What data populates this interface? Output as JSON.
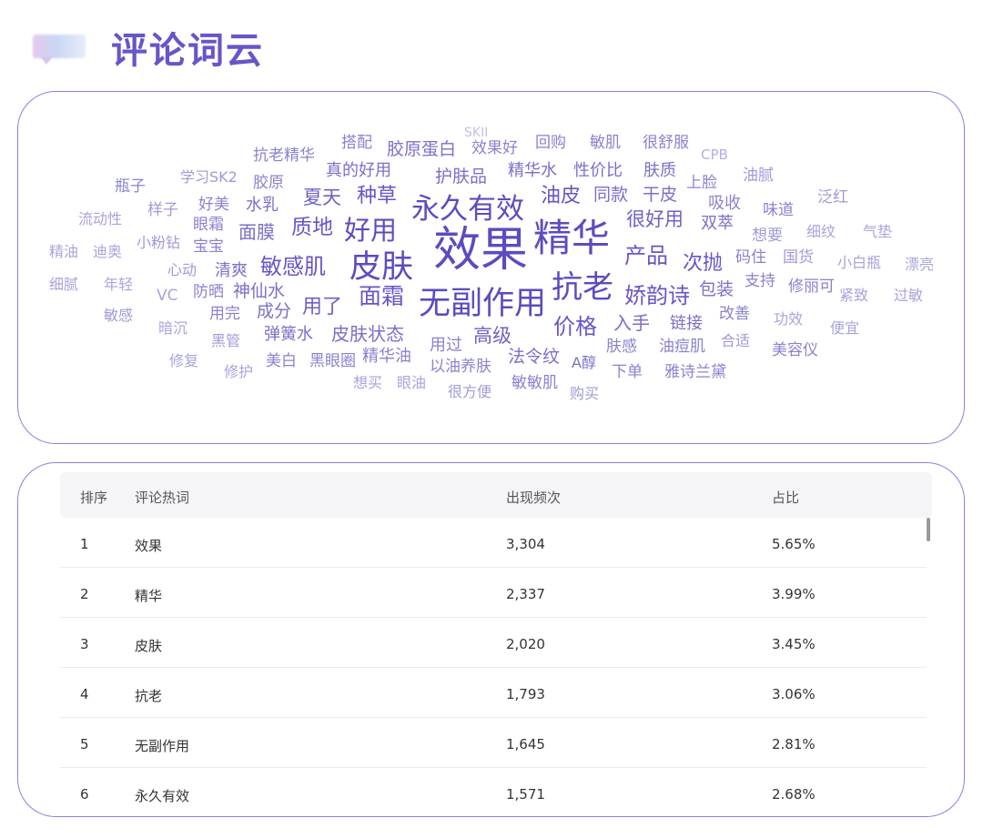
{
  "header": {
    "title": "评论词云",
    "icon": "chat-bubble-icon"
  },
  "colors": {
    "accent": "#6656c8",
    "border": "#8a80dd",
    "header_bg": "#f5f5f7"
  },
  "word_cloud": [
    {
      "text": "SKII"
    },
    {
      "text": "搭配"
    },
    {
      "text": "胶原蛋白"
    },
    {
      "text": "效果好"
    },
    {
      "text": "回购"
    },
    {
      "text": "敏肌"
    },
    {
      "text": "很舒服"
    },
    {
      "text": "抗老精华"
    },
    {
      "text": "CPB"
    },
    {
      "text": "真的好用"
    },
    {
      "text": "精华水"
    },
    {
      "text": "性价比"
    },
    {
      "text": "肤质"
    },
    {
      "text": "瓶子"
    },
    {
      "text": "学习SK2"
    },
    {
      "text": "胶原"
    },
    {
      "text": "护肤品"
    },
    {
      "text": "上脸"
    },
    {
      "text": "油腻"
    },
    {
      "text": "样子"
    },
    {
      "text": "好美"
    },
    {
      "text": "水乳"
    },
    {
      "text": "夏天"
    },
    {
      "text": "种草"
    },
    {
      "text": "油皮"
    },
    {
      "text": "同款"
    },
    {
      "text": "干皮"
    },
    {
      "text": "吸收"
    },
    {
      "text": "泛红"
    },
    {
      "text": "流动性"
    },
    {
      "text": "永久有效"
    },
    {
      "text": "味道"
    },
    {
      "text": "眼霜"
    },
    {
      "text": "很好用"
    },
    {
      "text": "双萃"
    },
    {
      "text": "面膜"
    },
    {
      "text": "质地"
    },
    {
      "text": "好用"
    },
    {
      "text": "细纹"
    },
    {
      "text": "气垫"
    },
    {
      "text": "精油"
    },
    {
      "text": "迪奥"
    },
    {
      "text": "小粉钻"
    },
    {
      "text": "宝宝"
    },
    {
      "text": "精华"
    },
    {
      "text": "想要"
    },
    {
      "text": "效果"
    },
    {
      "text": "产品"
    },
    {
      "text": "码住"
    },
    {
      "text": "国货"
    },
    {
      "text": "小白瓶"
    },
    {
      "text": "漂亮"
    },
    {
      "text": "心动"
    },
    {
      "text": "清爽"
    },
    {
      "text": "敏感肌"
    },
    {
      "text": "皮肤"
    },
    {
      "text": "次抛"
    },
    {
      "text": "细腻"
    },
    {
      "text": "年轻"
    },
    {
      "text": "支持"
    },
    {
      "text": "修丽可"
    },
    {
      "text": "VC"
    },
    {
      "text": "防晒"
    },
    {
      "text": "神仙水"
    },
    {
      "text": "抗老"
    },
    {
      "text": "包装"
    },
    {
      "text": "紧致"
    },
    {
      "text": "过敏"
    },
    {
      "text": "面霜"
    },
    {
      "text": "娇韵诗"
    },
    {
      "text": "用了"
    },
    {
      "text": "无副作用"
    },
    {
      "text": "敏感"
    },
    {
      "text": "用完"
    },
    {
      "text": "成分"
    },
    {
      "text": "改善"
    },
    {
      "text": "功效"
    },
    {
      "text": "暗沉"
    },
    {
      "text": "入手"
    },
    {
      "text": "链接"
    },
    {
      "text": "便宜"
    },
    {
      "text": "弹簧水"
    },
    {
      "text": "皮肤状态"
    },
    {
      "text": "价格"
    },
    {
      "text": "黑管"
    },
    {
      "text": "高级"
    },
    {
      "text": "合适"
    },
    {
      "text": "用过"
    },
    {
      "text": "肤感"
    },
    {
      "text": "油痘肌"
    },
    {
      "text": "美容仪"
    },
    {
      "text": "精华油"
    },
    {
      "text": "法令纹"
    },
    {
      "text": "修复"
    },
    {
      "text": "美白"
    },
    {
      "text": "黑眼圈"
    },
    {
      "text": "A醇"
    },
    {
      "text": "修护"
    },
    {
      "text": "以油养肤"
    },
    {
      "text": "下单"
    },
    {
      "text": "雅诗兰黛"
    },
    {
      "text": "想买"
    },
    {
      "text": "眼油"
    },
    {
      "text": "敏敏肌"
    },
    {
      "text": "很方便"
    },
    {
      "text": "购买"
    }
  ],
  "table": {
    "columns": {
      "rank": "排序",
      "word": "评论热词",
      "freq": "出现频次",
      "ratio": "占比"
    },
    "rows": [
      {
        "rank": "1",
        "word": "效果",
        "freq": "3,304",
        "ratio": "5.65%"
      },
      {
        "rank": "2",
        "word": "精华",
        "freq": "2,337",
        "ratio": "3.99%"
      },
      {
        "rank": "3",
        "word": "皮肤",
        "freq": "2,020",
        "ratio": "3.45%"
      },
      {
        "rank": "4",
        "word": "抗老",
        "freq": "1,793",
        "ratio": "3.06%"
      },
      {
        "rank": "5",
        "word": "无副作用",
        "freq": "1,645",
        "ratio": "2.81%"
      },
      {
        "rank": "6",
        "word": "永久有效",
        "freq": "1,571",
        "ratio": "2.68%"
      }
    ]
  }
}
